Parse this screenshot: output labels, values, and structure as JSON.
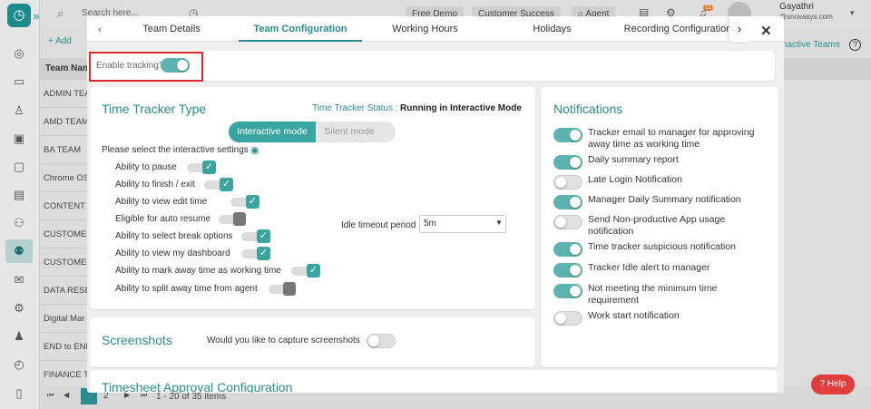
{
  "topbar": {
    "search_placeholder": "Search here...",
    "free_demo": "Free Demo",
    "customer_success": "Customer Success",
    "agent": "Agent",
    "notif_count": "11",
    "user_name": "Gayathri",
    "user_email": "@snovasys.com"
  },
  "background": {
    "add_label": "Add",
    "team_col": "Team Nam",
    "rows": [
      "ADMIN TEAM",
      "AMD TEAM",
      "BA TEAM",
      "Chrome OS",
      "CONTENT W",
      "CUSTOMER",
      "CUSTOMER",
      "DATA RESEA",
      "Digital Mar",
      "END to END",
      "FINANCE TE"
    ],
    "inactive_teams": "nactive Teams",
    "pager_page": "2",
    "pager_info": "1 - 20 of 35 items"
  },
  "modal": {
    "tabs": [
      "Team Details",
      "Team Configuration",
      "Working Hours",
      "Holidays",
      "Recording Configuration"
    ],
    "active_tab": "Team Configuration",
    "enable_tracking_label": "Enable tracking?",
    "enable_tracking_on": true,
    "tracker": {
      "title": "Time Tracker Type",
      "status_label": "Time Tracker Status :",
      "status_value": "Running in Interactive Mode",
      "mode_interactive": "Interactive mode",
      "mode_silent": "Silent mode",
      "select_settings": "Please select the interactive settings",
      "settings": [
        {
          "label": "Ability to pause",
          "on": true
        },
        {
          "label": "Ability to finish / exit",
          "on": true
        },
        {
          "label": "Ability to view edit time",
          "on": true
        },
        {
          "label": "Eligible for auto resume",
          "on": false
        },
        {
          "label": "Ability to select break options",
          "on": true
        },
        {
          "label": "Ability to view my dashboard",
          "on": true
        },
        {
          "label": "Ability to mark away time as working time",
          "on": true
        },
        {
          "label": "Ability to split away time from agent",
          "on": false
        }
      ],
      "idle_label": "Idle timeout period",
      "idle_value": "5m"
    },
    "screenshots": {
      "title": "Screenshots",
      "question": "Would you like to capture screenshots",
      "on": false
    },
    "timesheet_title": "Timesheet Approval Configuration",
    "notifications": {
      "title": "Notifications",
      "items": [
        {
          "label": "Tracker email to manager for approving away time as working time",
          "on": true
        },
        {
          "label": "Daily summary report",
          "on": true
        },
        {
          "label": "Late Login Notification",
          "on": false
        },
        {
          "label": "Manager Daily Summary notification",
          "on": true
        },
        {
          "label": "Send Non-productive App usage notification",
          "on": false
        },
        {
          "label": "Time tracker suspicious notification",
          "on": true
        },
        {
          "label": "Tracker Idle alert to manager",
          "on": true
        },
        {
          "label": "Not meeting the minimum time requirement",
          "on": true
        },
        {
          "label": "Work start notification",
          "on": false
        }
      ]
    }
  },
  "help_label": "Help",
  "colors": {
    "accent": "#2a8c8e",
    "toggle_on": "#5cb3b0",
    "help": "#e23c3c"
  }
}
